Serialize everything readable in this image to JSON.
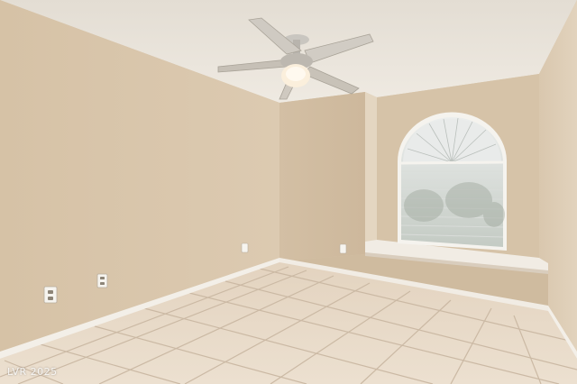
{
  "watermark": {
    "text": "LVR 2025"
  },
  "colors": {
    "wall_left": "#d8c5ab",
    "wall_back": "#d2bea3",
    "wall_right": "#dccbb3",
    "ceiling": "#ece6dc",
    "floor_tile": "#e8d9c8",
    "grout": "#cdbba7",
    "baseboard": "#f3efe8",
    "window_glass": "#c9cfc9",
    "window_frame": "#f7f5f0"
  },
  "icons": [
    "ceiling-fan-icon",
    "electrical-outlet-icon"
  ]
}
